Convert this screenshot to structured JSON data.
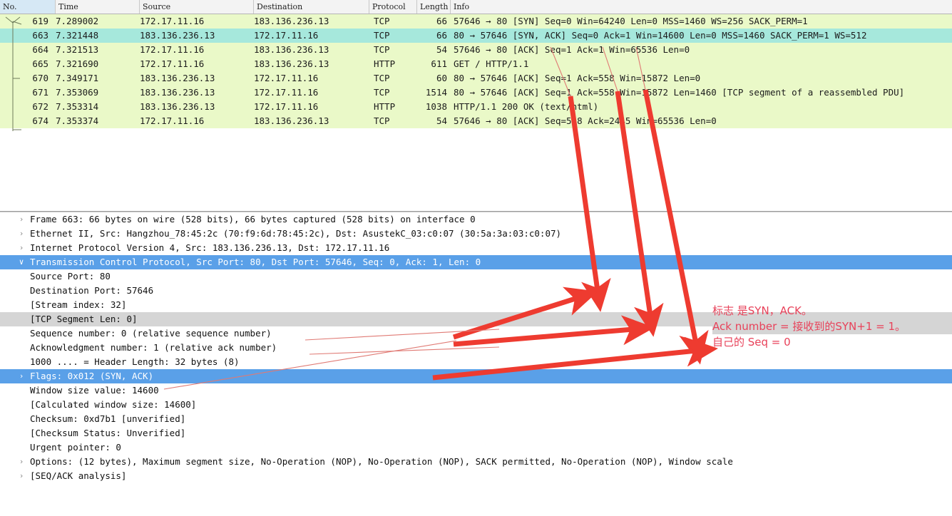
{
  "packet_list": {
    "columns": [
      {
        "key": "no",
        "label": "No."
      },
      {
        "key": "time",
        "label": "Time"
      },
      {
        "key": "source",
        "label": "Source"
      },
      {
        "key": "destination",
        "label": "Destination"
      },
      {
        "key": "protocol",
        "label": "Protocol"
      },
      {
        "key": "length",
        "label": "Length"
      },
      {
        "key": "info",
        "label": "Info"
      }
    ],
    "rows": [
      {
        "no": "619",
        "time": "7.289002",
        "source": "172.17.11.16",
        "destination": "183.136.236.13",
        "protocol": "TCP",
        "length": "66",
        "info": "57646 → 80 [SYN] Seq=0 Win=64240 Len=0 MSS=1460 WS=256 SACK_PERM=1",
        "selected": false
      },
      {
        "no": "663",
        "time": "7.321448",
        "source": "183.136.236.13",
        "destination": "172.17.11.16",
        "protocol": "TCP",
        "length": "66",
        "info": "80 → 57646 [SYN, ACK] Seq=0 Ack=1 Win=14600 Len=0 MSS=1460 SACK_PERM=1 WS=512",
        "selected": true
      },
      {
        "no": "664",
        "time": "7.321513",
        "source": "172.17.11.16",
        "destination": "183.136.236.13",
        "protocol": "TCP",
        "length": "54",
        "info": "57646 → 80 [ACK] Seq=1 Ack=1 Win=65536 Len=0",
        "selected": false
      },
      {
        "no": "665",
        "time": "7.321690",
        "source": "172.17.11.16",
        "destination": "183.136.236.13",
        "protocol": "HTTP",
        "length": "611",
        "info": "GET / HTTP/1.1",
        "selected": false
      },
      {
        "no": "670",
        "time": "7.349171",
        "source": "183.136.236.13",
        "destination": "172.17.11.16",
        "protocol": "TCP",
        "length": "60",
        "info": "80 → 57646 [ACK] Seq=1 Ack=558 Win=15872 Len=0",
        "selected": false
      },
      {
        "no": "671",
        "time": "7.353069",
        "source": "183.136.236.13",
        "destination": "172.17.11.16",
        "protocol": "TCP",
        "length": "1514",
        "info": "80 → 57646 [ACK] Seq=1 Ack=558 Win=15872 Len=1460 [TCP segment of a reassembled PDU]",
        "selected": false
      },
      {
        "no": "672",
        "time": "7.353314",
        "source": "183.136.236.13",
        "destination": "172.17.11.16",
        "protocol": "HTTP",
        "length": "1038",
        "info": "HTTP/1.1 200 OK  (text/html)",
        "selected": false
      },
      {
        "no": "674",
        "time": "7.353374",
        "source": "172.17.11.16",
        "destination": "183.136.236.13",
        "protocol": "TCP",
        "length": "54",
        "info": "57646 → 80 [ACK] Seq=558 Ack=2445 Win=65536 Len=0",
        "selected": false
      }
    ]
  },
  "detail_tree": [
    {
      "id": "frame",
      "depth": 0,
      "twisty": "›",
      "text": "Frame 663: 66 bytes on wire (528 bits), 66 bytes captured (528 bits) on interface 0",
      "style": "normal"
    },
    {
      "id": "ethernet",
      "depth": 0,
      "twisty": "›",
      "text": "Ethernet II, Src: Hangzhou_78:45:2c (70:f9:6d:78:45:2c), Dst: AsustekC_03:c0:07 (30:5a:3a:03:c0:07)",
      "style": "normal"
    },
    {
      "id": "ipv4",
      "depth": 0,
      "twisty": "›",
      "text": "Internet Protocol Version 4, Src: 183.136.236.13, Dst: 172.17.11.16",
      "style": "normal"
    },
    {
      "id": "tcp",
      "depth": 0,
      "twisty": "∨",
      "text": "Transmission Control Protocol, Src Port: 80, Dst Port: 57646, Seq: 0, Ack: 1, Len: 0",
      "style": "selected"
    },
    {
      "id": "src-port",
      "depth": 1,
      "twisty": "",
      "text": "Source Port: 80",
      "style": "normal"
    },
    {
      "id": "dst-port",
      "depth": 1,
      "twisty": "",
      "text": "Destination Port: 57646",
      "style": "normal"
    },
    {
      "id": "stream-index",
      "depth": 1,
      "twisty": "",
      "text": "[Stream index: 32]",
      "style": "normal"
    },
    {
      "id": "segment-len",
      "depth": 1,
      "twisty": "",
      "text": "[TCP Segment Len: 0]",
      "style": "grey"
    },
    {
      "id": "seq-number",
      "depth": 1,
      "twisty": "",
      "text": "Sequence number: 0    (relative sequence number)",
      "style": "normal"
    },
    {
      "id": "ack-number",
      "depth": 1,
      "twisty": "",
      "text": "Acknowledgment number: 1    (relative ack number)",
      "style": "normal"
    },
    {
      "id": "header-length",
      "depth": 1,
      "twisty": "",
      "text": "1000 .... = Header Length: 32 bytes (8)",
      "style": "normal"
    },
    {
      "id": "flags",
      "depth": 1,
      "twisty": "›",
      "text": "Flags: 0x012 (SYN, ACK)",
      "style": "selected"
    },
    {
      "id": "window-size-value",
      "depth": 1,
      "twisty": "",
      "text": "Window size value: 14600",
      "style": "normal"
    },
    {
      "id": "calculated-window-size",
      "depth": 1,
      "twisty": "",
      "text": "[Calculated window size: 14600]",
      "style": "normal"
    },
    {
      "id": "checksum",
      "depth": 1,
      "twisty": "",
      "text": "Checksum: 0xd7b1 [unverified]",
      "style": "normal"
    },
    {
      "id": "checksum-status",
      "depth": 1,
      "twisty": "",
      "text": "[Checksum Status: Unverified]",
      "style": "normal"
    },
    {
      "id": "urgent-pointer",
      "depth": 1,
      "twisty": "",
      "text": "Urgent pointer: 0",
      "style": "normal"
    },
    {
      "id": "options",
      "depth": 1,
      "twisty": "›",
      "text": "Options: (12 bytes), Maximum segment size, No-Operation (NOP), No-Operation (NOP), SACK permitted, No-Operation (NOP), Window scale",
      "style": "normal"
    },
    {
      "id": "seq-ack-analysis",
      "depth": 1,
      "twisty": "›",
      "text": "[SEQ/ACK analysis]",
      "style": "normal"
    }
  ],
  "annotations": {
    "note_lines": [
      {
        "text": "标志 是SYN，ACK。",
        "highlight": false
      },
      {
        "text": "Ack number = 接收到的SYN+1 = 1。",
        "highlight": true
      },
      {
        "text": "自己的 Seq = 0",
        "highlight": false
      }
    ],
    "arrow_color": "#ee3b30",
    "note_color": "#e8425a"
  },
  "colors": {
    "row_background": "#eaf9c8",
    "row_selected": "#a6e8dc",
    "tree_selected": "#5aa0e8",
    "tree_grey_highlight": "#d5d5d5",
    "header_background": "#f3f3f3"
  }
}
